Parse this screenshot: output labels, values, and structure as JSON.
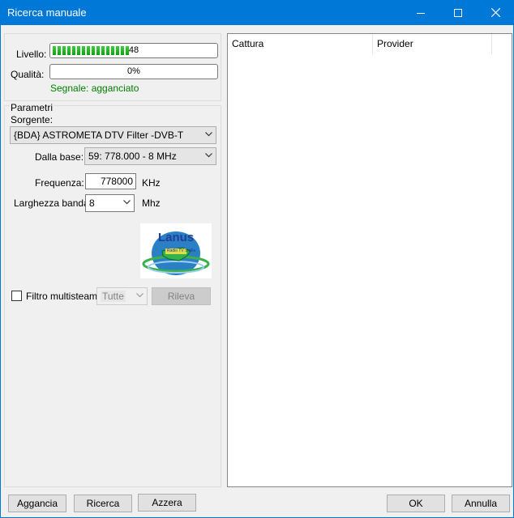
{
  "window": {
    "title": "Ricerca manuale"
  },
  "signal": {
    "level_label": "Livello:",
    "level_value": "48",
    "level_fraction": 0.48,
    "quality_label": "Qualità:",
    "quality_value": "0%",
    "status": "Segnale: agganciato",
    "status_color": "#008000",
    "bar_color": "#06b025"
  },
  "params": {
    "group_label": "Parametri",
    "source_label": "Sorgente:",
    "source_value": "{BDA} ASTROMETA DTV Filter -DVB-T",
    "base_label": "Dalla base:",
    "base_value": "59: 778.000 - 8 MHz",
    "freq_label": "Frequenza:",
    "freq_value": "778000",
    "freq_unit": "KHz",
    "bw_label": "Larghezza banda:",
    "bw_value": "8",
    "bw_unit": "Mhz"
  },
  "logo": {
    "text": "Lanus",
    "subtext": "Radio TV Sicilia"
  },
  "filter": {
    "label": "Filtro multisteam",
    "checked": false,
    "select_value": "Tutte",
    "detect_button": "Rileva"
  },
  "results": {
    "columns": [
      "Cattura",
      "Provider"
    ]
  },
  "buttons": {
    "hook": "Aggancia",
    "search": "Ricerca",
    "reset": "Azzera",
    "ok": "OK",
    "cancel": "Annulla"
  }
}
